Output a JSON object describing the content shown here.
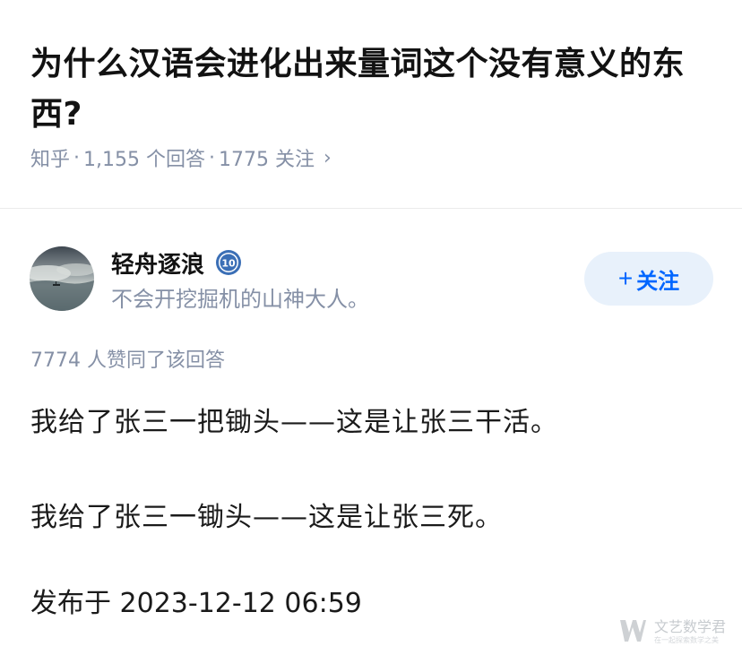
{
  "question": {
    "title": "为什么汉语会进化出来量词这个没有意义的东西?",
    "source": "知乎",
    "answers_count": "1,155 个回答",
    "followers_count": "1775 关注",
    "separator": "·",
    "chevron": "›"
  },
  "author": {
    "name": "轻舟逐浪",
    "level": "10",
    "bio": "不会开挖掘机的山神大人。",
    "follow_label": "关注",
    "follow_plus": "+"
  },
  "answer": {
    "votes": "7774 人赞同了该回答",
    "paragraphs": [
      "我给了张三一把锄头——这是让张三干活。",
      "我给了张三一锄头——这是让张三死。"
    ],
    "publish_time": "发布于 2023-12-12 06:59"
  },
  "watermark": {
    "name": "文艺数学君",
    "subtitle": "在一起探索数学之美"
  },
  "colors": {
    "accent": "#0066ff",
    "follow_bg": "#e8f1fb",
    "meta_text": "#8590a6",
    "title_text": "#121212"
  }
}
